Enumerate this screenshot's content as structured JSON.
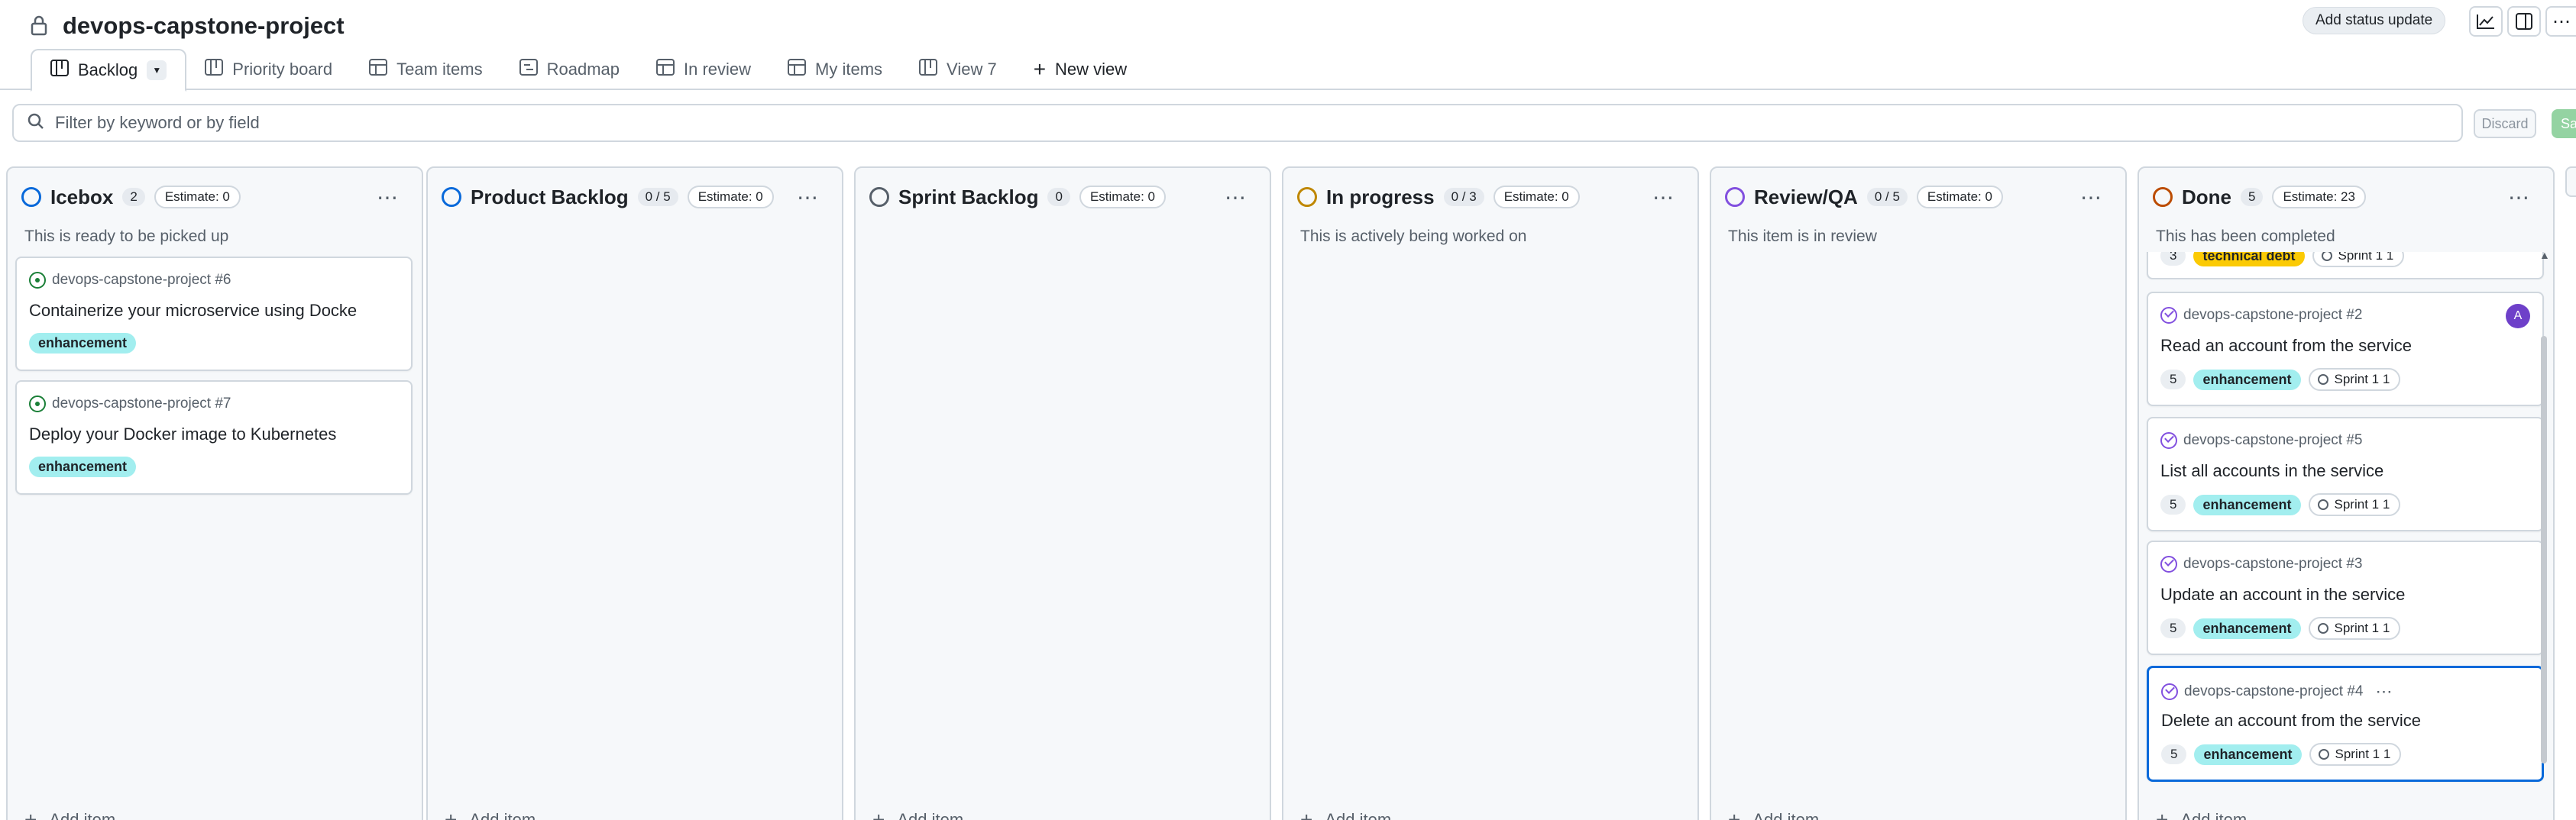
{
  "project": {
    "title": "devops-capstone-project",
    "status_button": "Add status update"
  },
  "tabs": [
    {
      "label": "Backlog",
      "icon": "board-icon",
      "active": true
    },
    {
      "label": "Priority board",
      "icon": "board-icon"
    },
    {
      "label": "Team items",
      "icon": "table-icon"
    },
    {
      "label": "Roadmap",
      "icon": "roadmap-icon"
    },
    {
      "label": "In review",
      "icon": "table-icon"
    },
    {
      "label": "My items",
      "icon": "table-icon"
    },
    {
      "label": "View 7",
      "icon": "board-icon"
    },
    {
      "label": "New view",
      "icon": "plus-icon"
    }
  ],
  "filter": {
    "placeholder": "Filter by keyword or by field",
    "discard_label": "Discard",
    "save_label": "Sa"
  },
  "columns": [
    {
      "name": "Icebox",
      "count": "2",
      "estimate": "Estimate: 0",
      "description": "This is ready to be picked up",
      "color": "#0969da"
    },
    {
      "name": "Product Backlog",
      "count": "0 / 5",
      "estimate": "Estimate: 0",
      "description": "",
      "color": "#0969da"
    },
    {
      "name": "Sprint Backlog",
      "count": "0",
      "estimate": "Estimate: 0",
      "description": "",
      "color": "#57606a"
    },
    {
      "name": "In progress",
      "count": "0 / 3",
      "estimate": "Estimate: 0",
      "description": "This is actively being worked on",
      "color": "#bf8700"
    },
    {
      "name": "Review/QA",
      "count": "0 / 5",
      "estimate": "Estimate: 0",
      "description": "This item is in review",
      "color": "#8250df"
    },
    {
      "name": "Done",
      "count": "5",
      "estimate": "Estimate: 23",
      "description": "This has been completed",
      "color": "#bc4c00"
    }
  ],
  "add_item_label": "Add item",
  "icebox_cards": [
    {
      "ref": "devops-capstone-project #6",
      "title": "Containerize your microservice using Docke",
      "label": "enhancement"
    },
    {
      "ref": "devops-capstone-project #7",
      "title": "Deploy your Docker image to Kubernetes",
      "label": "enhancement"
    }
  ],
  "done_partial_card": {
    "points": "3",
    "label": "technical debt",
    "sprint": "Sprint 1 1"
  },
  "done_cards": [
    {
      "ref": "devops-capstone-project #2",
      "title": "Read an account from the service",
      "points": "5",
      "label": "enhancement",
      "sprint": "Sprint 1 1",
      "assignee": "A"
    },
    {
      "ref": "devops-capstone-project #5",
      "title": "List all accounts in the service",
      "points": "5",
      "label": "enhancement",
      "sprint": "Sprint 1 1"
    },
    {
      "ref": "devops-capstone-project #3",
      "title": "Update an account in the service",
      "points": "5",
      "label": "enhancement",
      "sprint": "Sprint 1 1"
    },
    {
      "ref": "devops-capstone-project #4",
      "title": "Delete an account from the service",
      "points": "5",
      "label": "enhancement",
      "sprint": "Sprint 1 1"
    }
  ],
  "colors": {
    "accent": "#0969da",
    "enhancement": "#a2eeef",
    "technical_debt": "#fbca04",
    "avatar": "#6e40c9"
  }
}
